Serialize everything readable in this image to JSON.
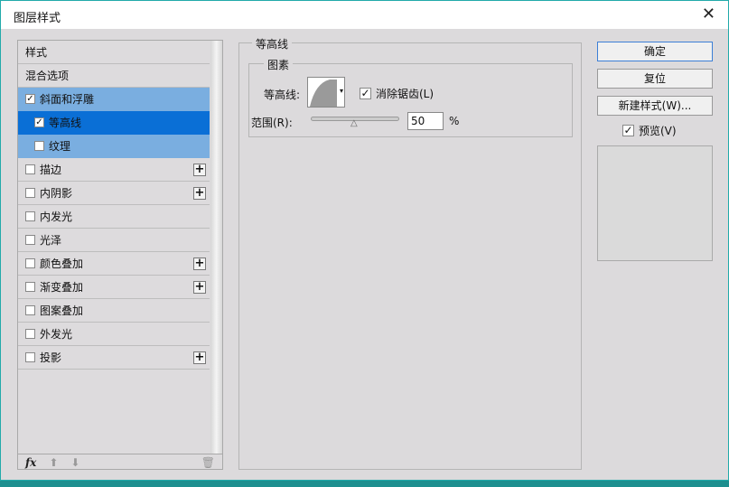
{
  "window": {
    "title": "图层样式"
  },
  "sidebar": {
    "items": [
      {
        "label": "样式",
        "checkbox": false,
        "checked": false,
        "plus": false
      },
      {
        "label": "混合选项",
        "checkbox": false,
        "checked": false,
        "plus": false
      },
      {
        "label": "斜面和浮雕",
        "checkbox": true,
        "checked": true,
        "plus": false,
        "state": "hl"
      },
      {
        "label": "等高线",
        "checkbox": true,
        "checked": true,
        "plus": false,
        "state": "sel",
        "sub": true
      },
      {
        "label": "纹理",
        "checkbox": true,
        "checked": false,
        "plus": false,
        "state": "hl",
        "sub": true
      },
      {
        "label": "描边",
        "checkbox": true,
        "checked": false,
        "plus": true
      },
      {
        "label": "内阴影",
        "checkbox": true,
        "checked": false,
        "plus": true
      },
      {
        "label": "内发光",
        "checkbox": true,
        "checked": false,
        "plus": false
      },
      {
        "label": "光泽",
        "checkbox": true,
        "checked": false,
        "plus": false
      },
      {
        "label": "颜色叠加",
        "checkbox": true,
        "checked": false,
        "plus": true
      },
      {
        "label": "渐变叠加",
        "checkbox": true,
        "checked": false,
        "plus": true
      },
      {
        "label": "图案叠加",
        "checkbox": true,
        "checked": false,
        "plus": false
      },
      {
        "label": "外发光",
        "checkbox": true,
        "checked": false,
        "plus": false
      },
      {
        "label": "投影",
        "checkbox": true,
        "checked": false,
        "plus": true
      }
    ],
    "fx_label": "fx"
  },
  "panel": {
    "group_title": "等高线",
    "sub_title": "图素",
    "contour_label": "等高线:",
    "antialias_label": "消除锯齿(L)",
    "antialias_checked": true,
    "range_label": "范围(R):",
    "range_value": "50",
    "range_unit": "%",
    "range_percent": 50
  },
  "buttons": {
    "ok": "确定",
    "reset": "复位",
    "new_style": "新建样式(W)...",
    "preview": "预览(V)",
    "preview_checked": true
  }
}
